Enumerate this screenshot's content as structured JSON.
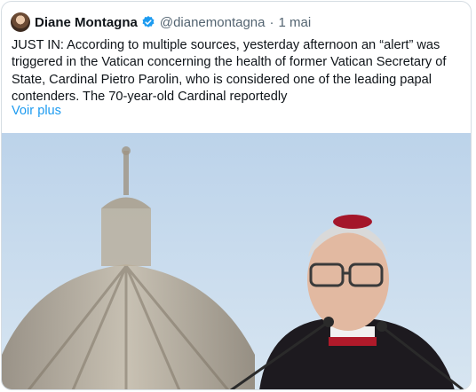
{
  "tweet": {
    "author_name": "Diane Montagna",
    "author_handle": "@dianemontagna",
    "date": "1 mai",
    "text": "JUST IN: According to multiple sources, yesterday afternoon an “alert” was triggered in the Vatican concerning the health of former Vatican Secretary of State, Cardinal Pietro Parolin, who is considered one of the leading papal contenders. The 70-year-old Cardinal reportedly",
    "more_label": "Voir plus",
    "separator": "·"
  },
  "icons": {
    "verified": "verified-badge-icon"
  },
  "colors": {
    "link": "#1d9bf0",
    "text": "#0f1419",
    "secondary": "#536471"
  }
}
